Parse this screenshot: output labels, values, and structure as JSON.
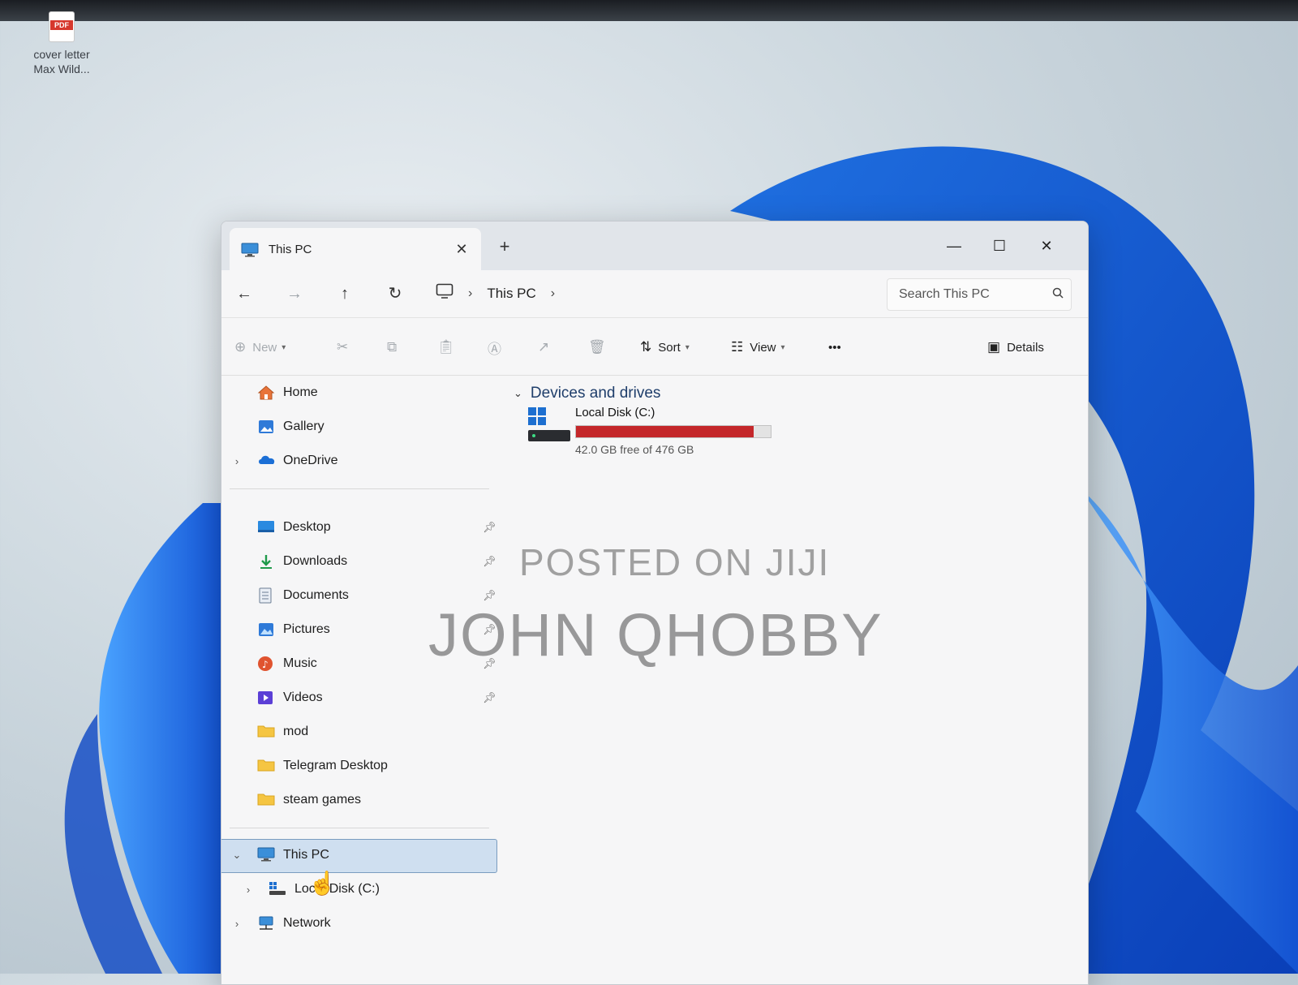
{
  "desktop": {
    "icons": [
      {
        "badge": "PDF",
        "label_line1": "cover letter",
        "label_line2": "Max Wild..."
      }
    ]
  },
  "window": {
    "tab": {
      "label": "This PC",
      "icon": "this-pc-icon",
      "close": "✕"
    },
    "new_tab": "+",
    "controls": {
      "minimize": "—",
      "maximize": "☐",
      "close": "✕"
    }
  },
  "address": {
    "back": "←",
    "forward": "→",
    "up": "↑",
    "refresh": "↻",
    "root_icon": "monitor-icon",
    "path": [
      "This PC"
    ],
    "sep": "›",
    "search_placeholder": "Search This PC"
  },
  "commands": {
    "new": "New",
    "sort": "Sort",
    "view": "View",
    "more": "•••",
    "details": "Details"
  },
  "sidebar": {
    "top": [
      {
        "label": "Home",
        "icon": "home-icon",
        "expandable": false
      },
      {
        "label": "Gallery",
        "icon": "gallery-icon",
        "expandable": false
      },
      {
        "label": "OneDrive",
        "icon": "onedrive-icon",
        "expandable": true
      }
    ],
    "pinned": [
      {
        "label": "Desktop",
        "icon": "desktop-folder-icon",
        "pinned": true
      },
      {
        "label": "Downloads",
        "icon": "downloads-icon",
        "pinned": true
      },
      {
        "label": "Documents",
        "icon": "documents-icon",
        "pinned": true
      },
      {
        "label": "Pictures",
        "icon": "pictures-icon",
        "pinned": true
      },
      {
        "label": "Music",
        "icon": "music-icon",
        "pinned": true
      },
      {
        "label": "Videos",
        "icon": "videos-icon",
        "pinned": true
      },
      {
        "label": "mod",
        "icon": "folder-icon",
        "pinned": false
      },
      {
        "label": "Telegram Desktop",
        "icon": "folder-icon",
        "pinned": false
      },
      {
        "label": "steam games",
        "icon": "folder-icon",
        "pinned": false
      }
    ],
    "tree": [
      {
        "label": "This PC",
        "icon": "this-pc-icon",
        "expanded": true,
        "selected": true
      },
      {
        "label": "Local Disk (C:)",
        "icon": "drive-icon",
        "expanded": false
      },
      {
        "label": "Network",
        "icon": "network-icon",
        "expanded": false
      }
    ]
  },
  "content": {
    "group": "Devices and drives",
    "drives": [
      {
        "name": "Local Disk (C:)",
        "free_text": "42.0 GB free of 476 GB",
        "used_fraction": 0.912,
        "bar_color": "#c4272a"
      }
    ]
  },
  "watermark": {
    "line1": "POSTED ON JIJI",
    "line2": "JOHN QHOBBY"
  }
}
